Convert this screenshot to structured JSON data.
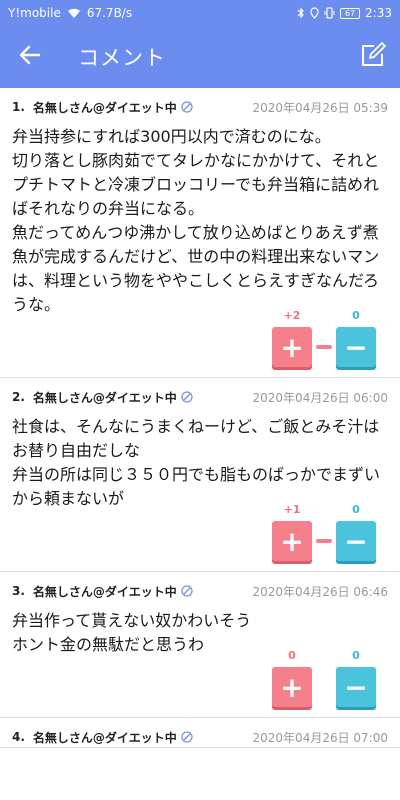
{
  "status_bar": {
    "carrier": "Y!mobile",
    "speed": "67.7B/s",
    "battery": "67",
    "time": "2:33"
  },
  "app_bar": {
    "title": "コメント"
  },
  "comments": [
    {
      "number": "1.",
      "author": "名無しさん@ダイエット中",
      "date": "2020年04月26日 05:39",
      "body": "弁当持参にすれば300円以内で済むのにな。\n切り落とし豚肉茹でてタレかなにかかけて、それとプチトマトと冷凍ブロッコリーでも弁当箱に詰めればそれなりの弁当になる。\n魚だってめんつゆ沸かして放り込めばとりあえず煮魚が完成するんだけど、世の中の料理出来ないマンは、料理という物をややこしくとらえすぎなんだろうな。",
      "plus_count": "+2",
      "minus_count": "0",
      "plus_ratio": 1.0
    },
    {
      "number": "2.",
      "author": "名無しさん@ダイエット中",
      "date": "2020年04月26日 06:00",
      "body": "社食は、そんなにうまくねーけど、ご飯とみそ汁はお替り自由だしな\n弁当の所は同じ３５０円でも脂ものばっかでまずいから頼まないが",
      "plus_count": "+1",
      "minus_count": "0",
      "plus_ratio": 1.0
    },
    {
      "number": "3.",
      "author": "名無しさん@ダイエット中",
      "date": "2020年04月26日 06:46",
      "body": "弁当作って貰えない奴かわいそう\nホント金の無駄だと思うわ",
      "plus_count": "0",
      "minus_count": "0",
      "plus_ratio": 0
    },
    {
      "number": "4.",
      "author": "名無しさん@ダイエット中",
      "date": "2020年04月26日 07:00",
      "body": "",
      "plus_count": "",
      "minus_count": "",
      "plus_ratio": 0
    }
  ],
  "vote": {
    "plus_label": "+",
    "minus_label": "−"
  },
  "icons": {
    "back": "arrow-left-icon",
    "edit": "compose-icon",
    "verified": "verified-icon"
  },
  "colors": {
    "primary": "#6c8df0",
    "plus": "#f5808c",
    "minus": "#4cc3dd"
  }
}
